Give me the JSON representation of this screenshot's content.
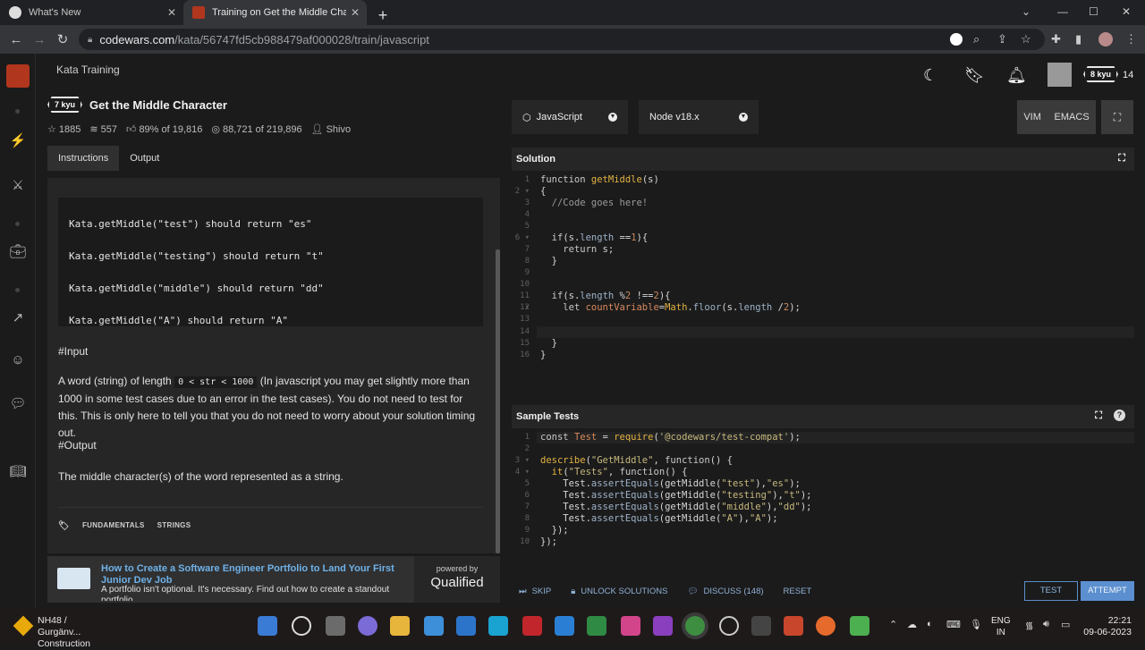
{
  "browser": {
    "tabs": [
      {
        "label": "What's New",
        "active": false
      },
      {
        "label": "Training on Get the Middle Chara",
        "active": true
      }
    ],
    "new_tab": "+",
    "url_host": "codewars.com",
    "url_path": "/kata/56747fd5cb988479af000028/train/javascript"
  },
  "header": {
    "section": "Kata Training",
    "user_rank": "8 kyu",
    "honor": "14"
  },
  "kata": {
    "rank": "7 kyu",
    "title": "Get the Middle Character",
    "stats": {
      "stars": "1885",
      "collections": "557",
      "satisfaction": "89%",
      "satisfaction_of": "of 19,816",
      "completed": "88,721",
      "completed_of": "of 219,896",
      "author": "Shivo"
    },
    "tabs": [
      "Instructions",
      "Output"
    ],
    "examples": [
      "Kata.getMiddle(\"test\") should return \"es\"",
      "Kata.getMiddle(\"testing\") should return \"t\"",
      "Kata.getMiddle(\"middle\") should return \"dd\"",
      "Kata.getMiddle(\"A\") should return \"A\""
    ],
    "input_heading": "#Input",
    "input_text_a": "A word (string) of length",
    "input_code": "0 < str < 1000",
    "input_text_b": "(In javascript you may get slightly more than 1000 in some test cases due to an error in the test cases). You do not need to test for this. This is only here to tell you that you do not need to worry about your solution timing out.",
    "output_heading": "#Output",
    "output_text": "The middle character(s) of the word represented as a string.",
    "tags": [
      "FUNDAMENTALS",
      "STRINGS"
    ]
  },
  "promo": {
    "title": "How to Create a Software Engineer Portfolio to Land Your First Junior Dev Job",
    "desc": "A portfolio isn't optional. It's necessary. Find out how to create a standout portfolio",
    "powered_by": "powered by",
    "brand": "Qualified"
  },
  "editor": {
    "language": "JavaScript",
    "runtime": "Node v18.x",
    "modes": [
      "VIM",
      "EMACS"
    ],
    "solution_title": "Solution",
    "tests_title": "Sample Tests"
  },
  "actions": {
    "skip": "SKIP",
    "unlock": "UNLOCK SOLUTIONS",
    "discuss": "DISCUSS (148)",
    "reset": "RESET",
    "test": "TEST",
    "attempt": "ATTEMPT"
  },
  "taskbar": {
    "weather_title": "NH48 / Gurgänv...",
    "weather_sub": "Construction",
    "lang_top": "ENG",
    "lang_bottom": "IN",
    "time": "22:21",
    "date": "09-06-2023"
  },
  "colors": {
    "accent_blue": "#5b8fd0",
    "codewars_red": "#b1361e"
  }
}
